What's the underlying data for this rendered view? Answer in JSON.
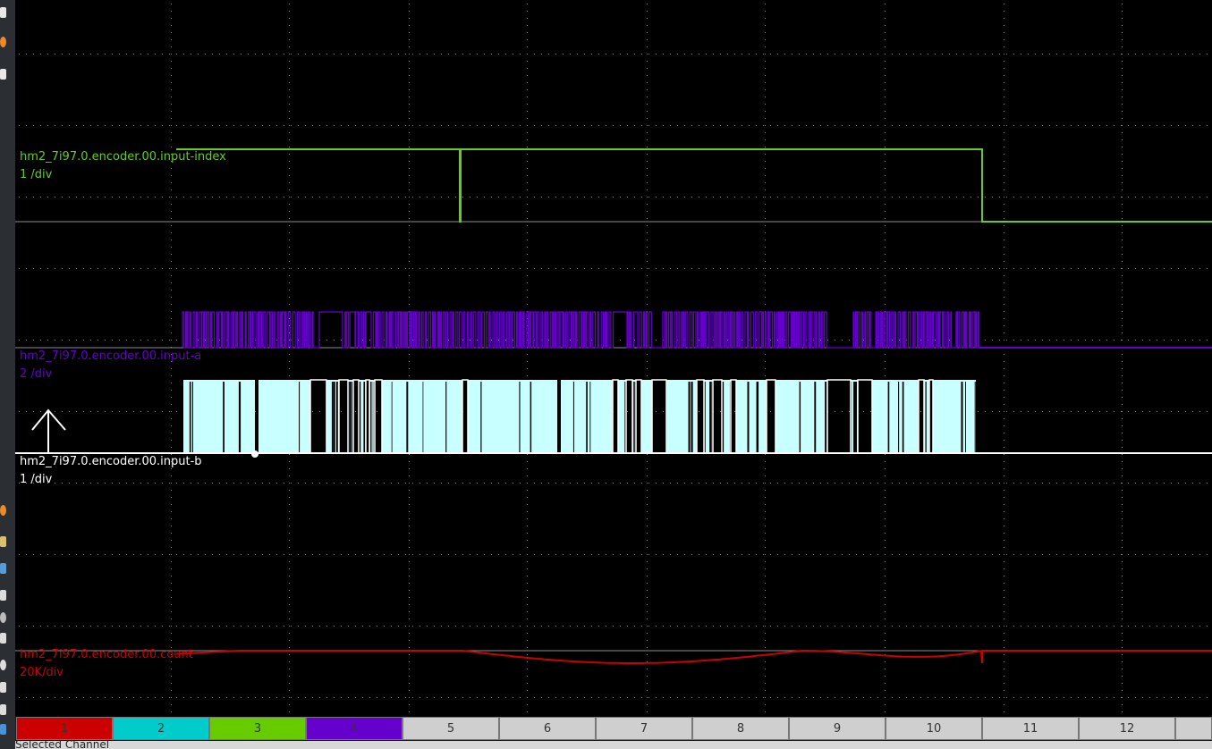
{
  "channels": [
    {
      "name": "hm2_7i97.0.encoder.00.input-index",
      "scale": "1 /div",
      "color": "#66cc22"
    },
    {
      "name": "hm2_7i97.0.encoder.00.input-a",
      "scale": "2 /div",
      "color": "#6600cc"
    },
    {
      "name": "hm2_7i97.0.encoder.00.input-b",
      "scale": "1 /div",
      "color": "#ffffff"
    },
    {
      "name": "hm2_7i97.0.encoder.00.count",
      "scale": "20K/div",
      "color": "#cc0000"
    }
  ],
  "channel_buttons": [
    {
      "label": "1",
      "color": "#cc0000"
    },
    {
      "label": "2",
      "color": "#00cccc"
    },
    {
      "label": "3",
      "color": "#66cc00"
    },
    {
      "label": "4",
      "color": "#6600cc"
    },
    {
      "label": "5",
      "color": "#cfcfcf"
    },
    {
      "label": "6",
      "color": "#cfcfcf"
    },
    {
      "label": "7",
      "color": "#cfcfcf"
    },
    {
      "label": "8",
      "color": "#cfcfcf"
    },
    {
      "label": "9",
      "color": "#cfcfcf"
    },
    {
      "label": "10",
      "color": "#cfcfcf"
    },
    {
      "label": "11",
      "color": "#cfcfcf"
    },
    {
      "label": "12",
      "color": "#cfcfcf"
    }
  ],
  "status": {
    "text": "Selected Channel"
  },
  "taskbar_icons": [
    "window-icon",
    "firefox-icon",
    "window-icon",
    "firefox-icon",
    "file-manager-icon",
    "document-icon",
    "eject-icon",
    "disc-icon",
    "package-icon",
    "record-icon",
    "pen-icon",
    "key-icon",
    "screen-icon"
  ]
}
